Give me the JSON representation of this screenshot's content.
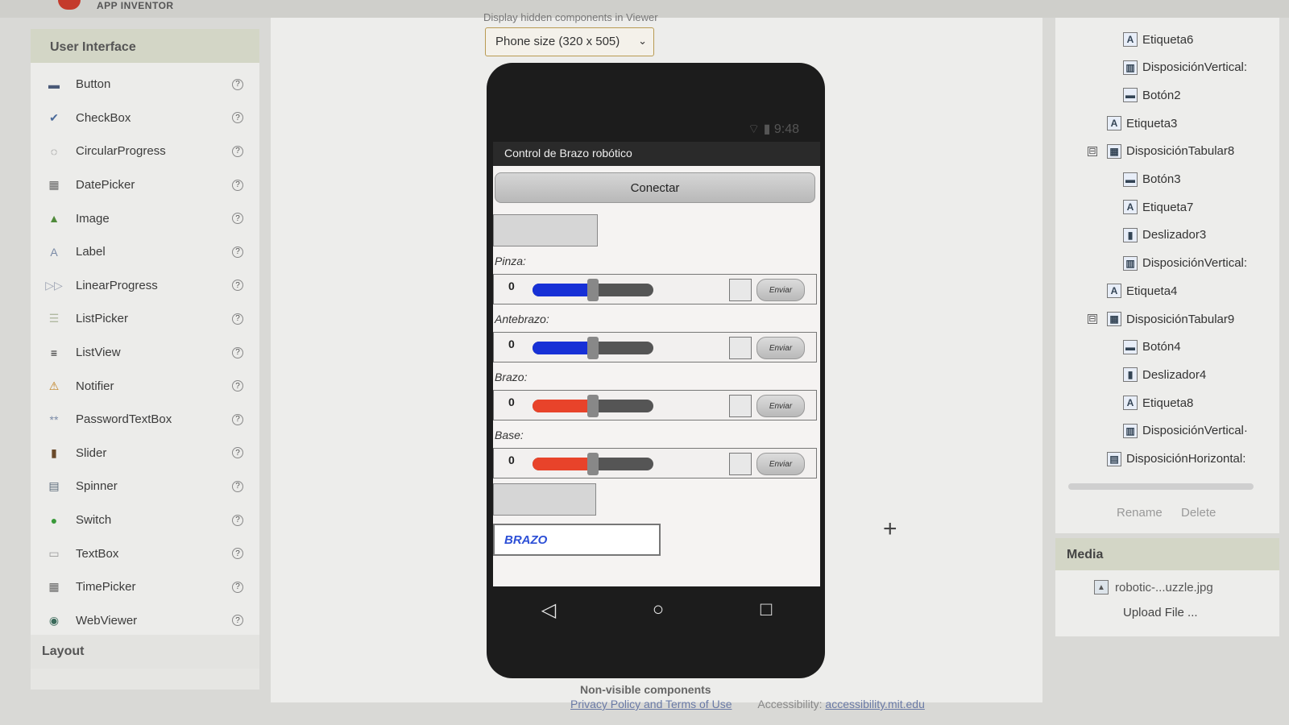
{
  "app": {
    "title": "APP INVENTOR"
  },
  "palette": {
    "header": "User Interface",
    "items": [
      {
        "label": "Button",
        "icon": "button-icon",
        "glyph": "▬",
        "color": "#4a5a78"
      },
      {
        "label": "CheckBox",
        "icon": "checkbox-icon",
        "glyph": "✔",
        "color": "#4a6a9a"
      },
      {
        "label": "CircularProgress",
        "icon": "circular-progress-icon",
        "glyph": "◌",
        "color": "#555555"
      },
      {
        "label": "DatePicker",
        "icon": "date-picker-icon",
        "glyph": "▦",
        "color": "#666666"
      },
      {
        "label": "Image",
        "icon": "image-icon",
        "glyph": "▲",
        "color": "#4f8a3a"
      },
      {
        "label": "Label",
        "icon": "label-icon",
        "glyph": "A",
        "color": "#7a8aa6"
      },
      {
        "label": "LinearProgress",
        "icon": "linear-progress-icon",
        "glyph": "▷▷",
        "color": "#9aa0b0"
      },
      {
        "label": "ListPicker",
        "icon": "list-picker-icon",
        "glyph": "☰",
        "color": "#b0b8a0"
      },
      {
        "label": "ListView",
        "icon": "list-view-icon",
        "glyph": "≡",
        "color": "#222222"
      },
      {
        "label": "Notifier",
        "icon": "notifier-icon",
        "glyph": "⚠",
        "color": "#c08020"
      },
      {
        "label": "PasswordTextBox",
        "icon": "password-textbox-icon",
        "glyph": "**",
        "color": "#7a8aa6"
      },
      {
        "label": "Slider",
        "icon": "slider-icon",
        "glyph": "▮",
        "color": "#6a4a2a"
      },
      {
        "label": "Spinner",
        "icon": "spinner-icon",
        "glyph": "▤",
        "color": "#5a6a7a"
      },
      {
        "label": "Switch",
        "icon": "switch-icon",
        "glyph": "●",
        "color": "#3a9a3a"
      },
      {
        "label": "TextBox",
        "icon": "textbox-icon",
        "glyph": "▭",
        "color": "#9a9a9a"
      },
      {
        "label": "TimePicker",
        "icon": "time-picker-icon",
        "glyph": "▦",
        "color": "#666666"
      },
      {
        "label": "WebViewer",
        "icon": "web-viewer-icon",
        "glyph": "◉",
        "color": "#3a6a5a"
      }
    ],
    "help_glyph": "?",
    "footer": "Layout"
  },
  "viewer": {
    "hidden_components_text": "Display hidden components in Viewer",
    "size_select": "Phone size (320 x 505)",
    "status_time": "9:48",
    "screen_title": "Control de Brazo robótico",
    "connect_label": "Conectar",
    "sliders": [
      {
        "label": "Pinza:",
        "value": "0",
        "send": "Enviar",
        "color": "#1730d6",
        "level": 0.5
      },
      {
        "label": "Antebrazo:",
        "value": "0",
        "send": "Enviar",
        "color": "#1730d6",
        "level": 0.5
      },
      {
        "label": "Brazo:",
        "value": "0",
        "send": "Enviar",
        "color": "#e8432a",
        "level": 0.5
      },
      {
        "label": "Base:",
        "value": "0",
        "send": "Enviar",
        "color": "#e8432a",
        "level": 0.5
      }
    ],
    "brazo_text": "BRAZO",
    "non_visible": "Non-visible components"
  },
  "footer": {
    "privacy": "Privacy Policy and Terms of Use",
    "accessibility_label": "Accessibility:",
    "accessibility_link": "accessibility.mit.edu"
  },
  "tree": {
    "items": [
      {
        "label": "Etiqueta6",
        "icon": "label-icon",
        "glyph": "A"
      },
      {
        "label": "DisposiciónVertical:",
        "icon": "vertical-arrangement-icon",
        "glyph": "▥"
      },
      {
        "label": "Botón2",
        "icon": "button-icon",
        "glyph": "▬"
      },
      {
        "label": "Etiqueta3",
        "icon": "label-icon",
        "glyph": "A"
      },
      {
        "label": "DisposiciónTabular8",
        "icon": "table-arrangement-icon",
        "glyph": "▦",
        "toggle": "⊟"
      },
      {
        "label": "Botón3",
        "icon": "button-icon",
        "glyph": "▬"
      },
      {
        "label": "Etiqueta7",
        "icon": "label-icon",
        "glyph": "A"
      },
      {
        "label": "Deslizador3",
        "icon": "slider-icon",
        "glyph": "▮"
      },
      {
        "label": "DisposiciónVertical:",
        "icon": "vertical-arrangement-icon",
        "glyph": "▥"
      },
      {
        "label": "Etiqueta4",
        "icon": "label-icon",
        "glyph": "A"
      },
      {
        "label": "DisposiciónTabular9",
        "icon": "table-arrangement-icon",
        "glyph": "▦",
        "toggle": "⊟"
      },
      {
        "label": "Botón4",
        "icon": "button-icon",
        "glyph": "▬"
      },
      {
        "label": "Deslizador4",
        "icon": "slider-icon",
        "glyph": "▮"
      },
      {
        "label": "Etiqueta8",
        "icon": "label-icon",
        "glyph": "A"
      },
      {
        "label": "DisposiciónVertical·",
        "icon": "vertical-arrangement-icon",
        "glyph": "▥"
      },
      {
        "label": "DisposiciónHorizontal:",
        "icon": "horizontal-arrangement-icon",
        "glyph": "▤"
      }
    ],
    "rename": "Rename",
    "delete": "Delete"
  },
  "media": {
    "header": "Media",
    "file": "robotic-...uzzle.jpg",
    "upload": "Upload File ..."
  }
}
